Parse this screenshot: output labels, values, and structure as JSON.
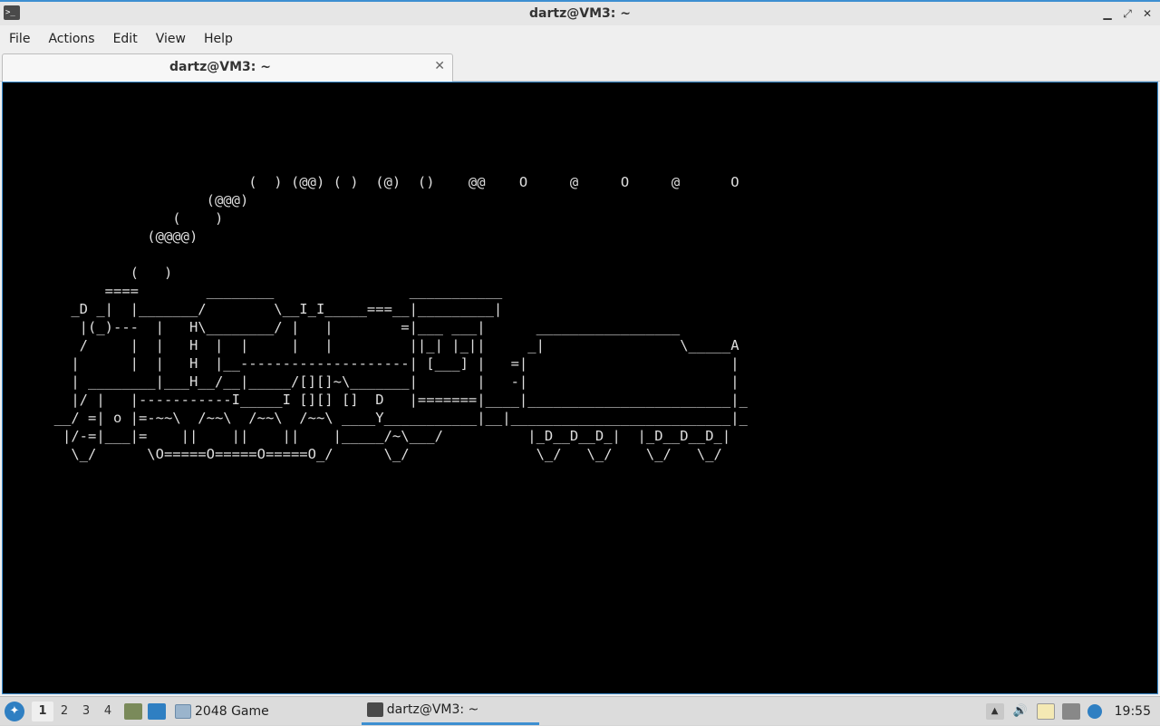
{
  "window": {
    "title": "dartz@VM3: ~",
    "app_icon_glyph": ">_",
    "controls": {
      "minimize": "▁",
      "maximize": "⤢",
      "close": "✕"
    }
  },
  "menubar": {
    "items": [
      "File",
      "Actions",
      "Edit",
      "View",
      "Help"
    ]
  },
  "tabs": [
    {
      "label": "dartz@VM3: ~",
      "close": "✕"
    }
  ],
  "terminal": {
    "output": "                            (  ) (@@) ( )  (@)  ()    @@    O     @     O     @      O\n                       (@@@)\n                   (    )\n                (@@@@)\n\n              (   )\n           ====        ________                ___________\n       _D _|  |_______/        \\__I_I_____===__|_________|\n        |(_)---  |   H\\________/ |   |        =|___ ___|      _________________\n        /     |  |   H  |  |     |   |         ||_| |_||     _|                \\_____A\n       |      |  |   H  |__--------------------| [___] |   =|                        |\n       | ________|___H__/__|_____/[][]~\\_______|       |   -|                        |\n       |/ |   |-----------I_____I [][] []  D   |=======|____|________________________|_\n     __/ =| o |=-~~\\  /~~\\  /~~\\  /~~\\ ____Y___________|__|__________________________|_\n      |/-=|___|=    ||    ||    ||    |_____/~\\___/          |_D__D__D_|  |_D__D__D_|\n       \\_/      \\O=====O=====O=====O_/      \\_/               \\_/   \\_/    \\_/   \\_/"
  },
  "taskbar": {
    "start_glyph": "✦",
    "desktops": [
      "1",
      "2",
      "3",
      "4"
    ],
    "tasks": [
      {
        "label": "2048 Game"
      },
      {
        "label": "dartz@VM3: ~"
      }
    ],
    "tray": {
      "up_glyph": "▲",
      "volume_glyph": "🔊",
      "clock": "19:55"
    }
  },
  "colors": {
    "accent": "#3d8fd1",
    "terminal_bg": "#000000",
    "terminal_fg": "#dedede"
  }
}
